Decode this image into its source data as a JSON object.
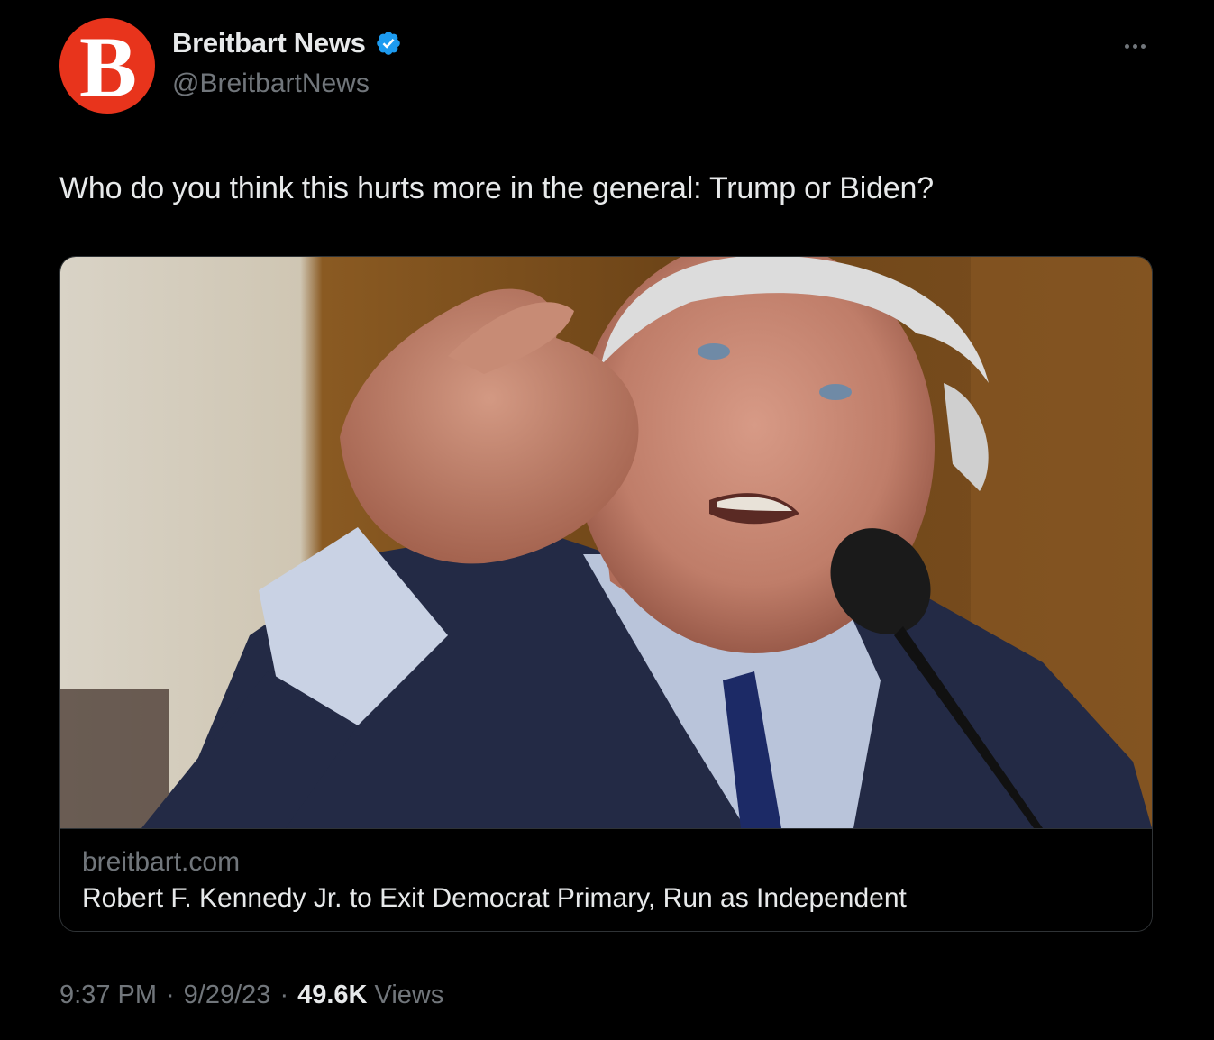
{
  "author": {
    "avatar_letter": "B",
    "name": "Breitbart News",
    "handle": "@BreitbartNews",
    "verified_icon": "verified-badge-icon",
    "avatar_color": "#e8341c"
  },
  "tweet": {
    "text": "Who do you think this hurts more in the general: Trump or Biden?",
    "more_icon": "more-options-icon"
  },
  "card": {
    "image_icon": "photo-of-man-pointing-at-microphone",
    "domain": "breitbart.com",
    "title": "Robert F. Kennedy Jr. to Exit Democrat Primary, Run as Independent"
  },
  "meta": {
    "time": "9:37 PM",
    "separator": "·",
    "date": "9/29/23",
    "views_count": "49.6K",
    "views_label": "Views"
  },
  "colors": {
    "background": "#000000",
    "primary_text": "#e7e9ea",
    "secondary_text": "#71767b",
    "verified_blue": "#1d9bf0",
    "border": "#2f3336"
  }
}
